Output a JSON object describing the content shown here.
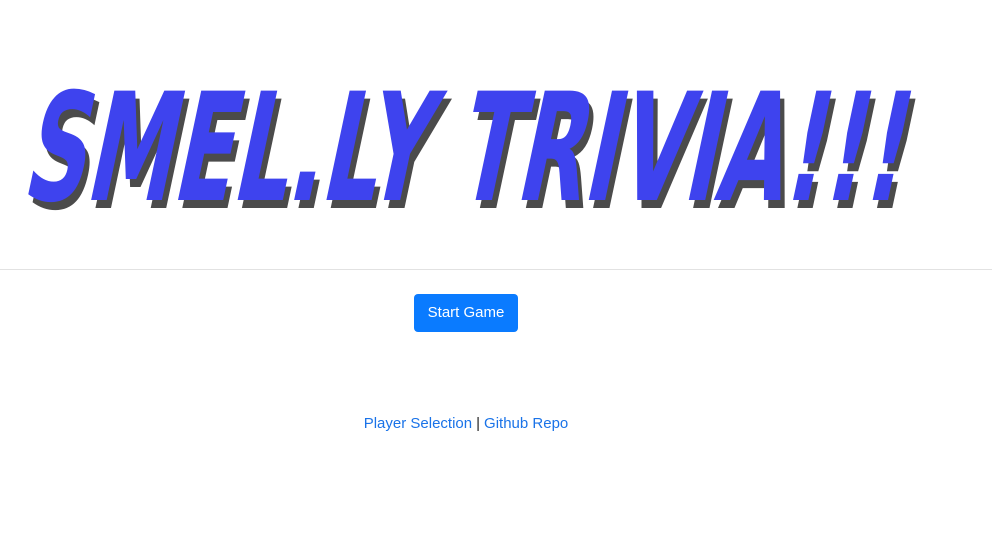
{
  "header": {
    "logo_text": "SMEL.LY TRIVIA!!!"
  },
  "main": {
    "start_button_label": "Start Game"
  },
  "footer": {
    "player_selection_label": "Player Selection",
    "separator": "|",
    "github_label": "Github Repo"
  },
  "colors": {
    "logo_fill": "#3e43ee",
    "logo_shadow": "#4b4b4b",
    "button_bg": "#0a7bff",
    "link": "#1a73e8"
  }
}
